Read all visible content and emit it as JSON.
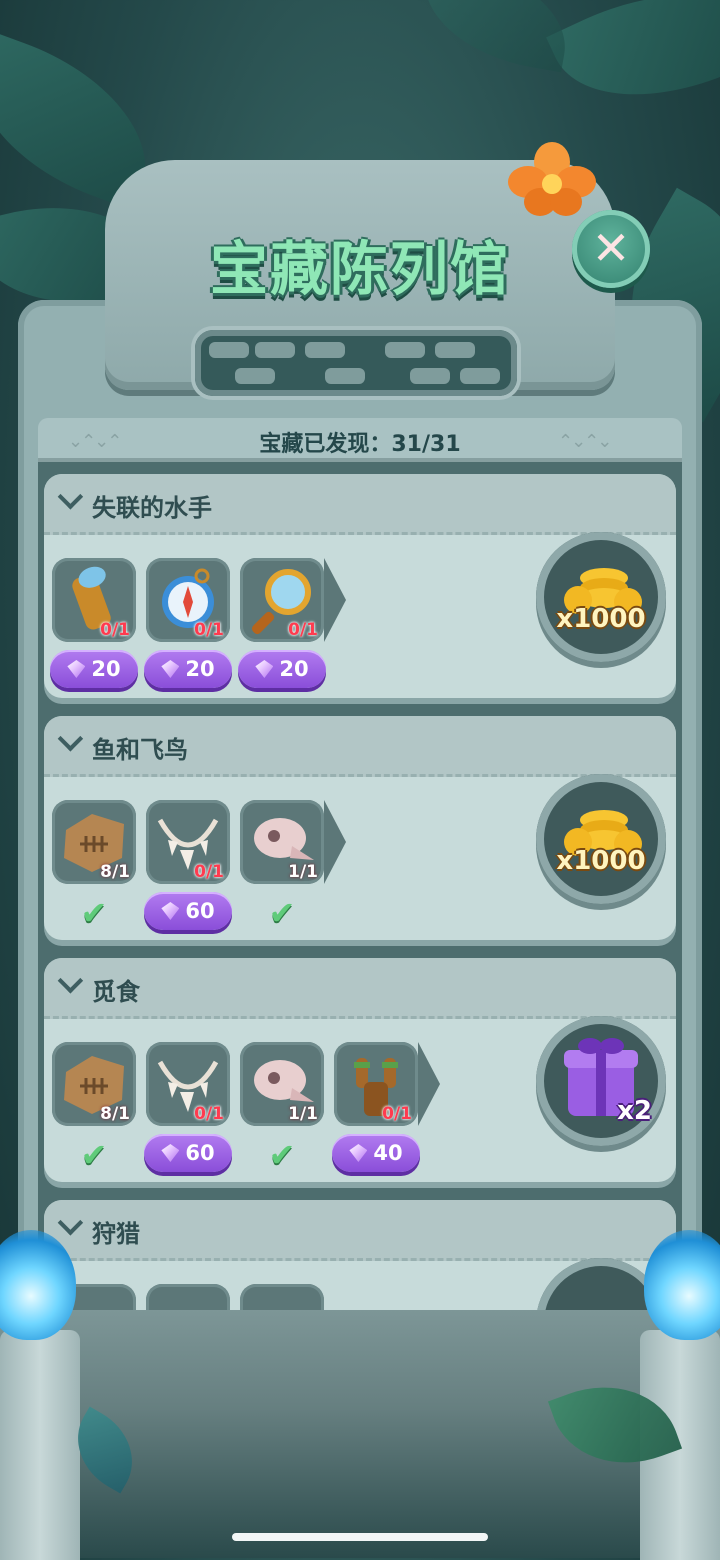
{
  "title": "宝藏陈列馆",
  "progress": {
    "label": "宝藏已发现：31/31",
    "found": 31,
    "total": 31
  },
  "close_icon": "close-x-icon",
  "collections": [
    {
      "title": "失联的水手",
      "items": [
        {
          "icon": "spyglass-icon",
          "count": "0/1",
          "gems": "20"
        },
        {
          "icon": "compass-icon",
          "count": "0/1",
          "gems": "20"
        },
        {
          "icon": "magnifier-icon",
          "count": "0/1",
          "gems": "20"
        }
      ],
      "reward": {
        "icon": "gold-coins-icon",
        "label": "x1000"
      }
    },
    {
      "title": "鱼和飞鸟",
      "items": [
        {
          "icon": "fish-fossil-icon",
          "count": "8/1",
          "gems": null
        },
        {
          "icon": "tooth-necklace-icon",
          "count": "0/1",
          "gems": "60"
        },
        {
          "icon": "bird-skull-icon",
          "count": "1/1",
          "gems": null
        }
      ],
      "reward": {
        "icon": "gold-coins-icon",
        "label": "x1000"
      }
    },
    {
      "title": "觅食",
      "items": [
        {
          "icon": "fish-fossil-icon",
          "count": "8/1",
          "gems": null
        },
        {
          "icon": "tooth-necklace-icon",
          "count": "0/1",
          "gems": "60"
        },
        {
          "icon": "bird-skull-icon",
          "count": "1/1",
          "gems": null
        },
        {
          "icon": "slingshot-icon",
          "count": "0/1",
          "gems": "40"
        }
      ],
      "reward": {
        "icon": "purple-gift-icon",
        "label": "x2"
      }
    },
    {
      "title": "狩猎",
      "items": [],
      "reward": {
        "icon": "gold-coins-icon",
        "label": ""
      }
    }
  ],
  "colors": {
    "gem_button": "#9a5ee3",
    "check": "#5fcb7a",
    "title_green": "#8fe7b6",
    "count_red": "#ff3b4f"
  }
}
